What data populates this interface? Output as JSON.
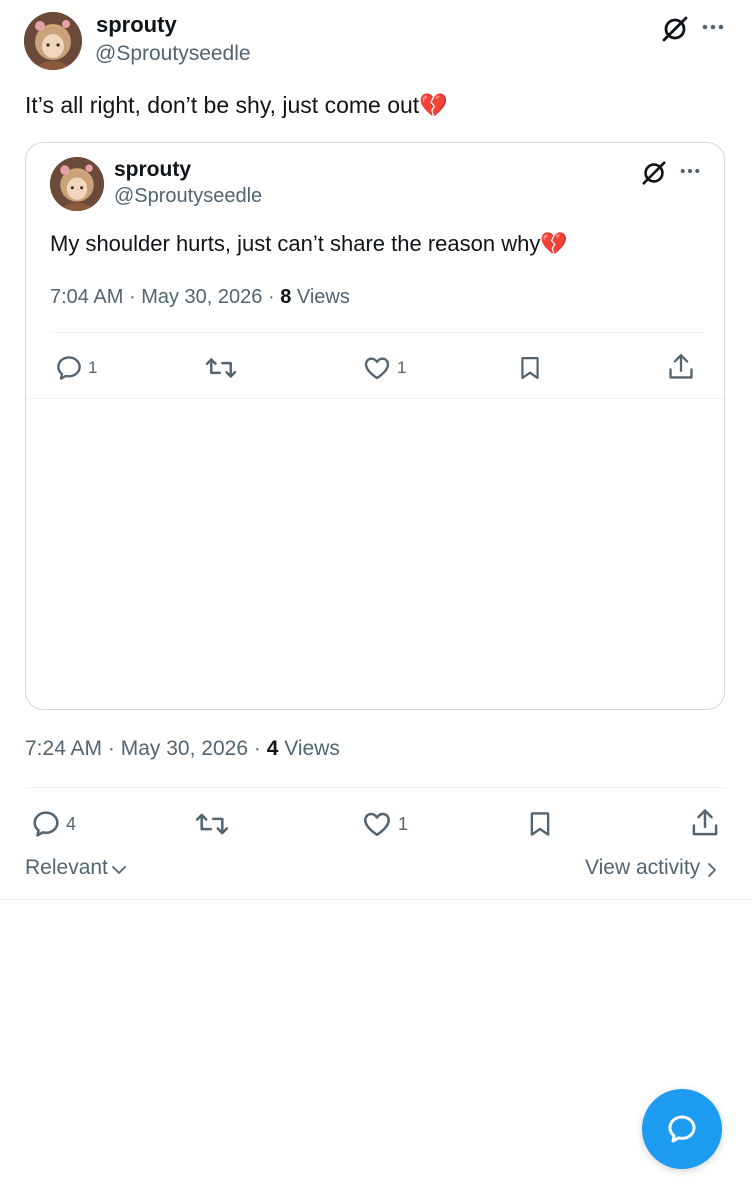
{
  "tweet": {
    "author": {
      "display_name": "sprouty",
      "handle": "@Sproutyseedle"
    },
    "text": "It’s all right, don’t be shy, just come out",
    "emoji": "💔",
    "time": "7:24 AM",
    "date": "May 30, 2026",
    "views_count": "4",
    "views_label": "Views",
    "actions": {
      "replies": "4",
      "reposts": "",
      "likes": "1"
    }
  },
  "quoted_tweet": {
    "author": {
      "display_name": "sprouty",
      "handle": "@Sproutyseedle"
    },
    "text": "My shoulder hurts, just can’t share the reason why",
    "emoji": "💔",
    "time": "7:04 AM",
    "date": "May 30, 2026",
    "views_count": "8",
    "views_label": "Views",
    "actions": {
      "replies": "1",
      "reposts": "",
      "likes": "1"
    }
  },
  "replies_bar": {
    "sort_label": "Relevant",
    "activity_label": "View activity"
  },
  "separator": "·",
  "icons": {
    "grok": "grok-icon",
    "more": "more-icon",
    "reply": "reply-icon",
    "repost": "repost-icon",
    "like": "heart-icon",
    "bookmark": "bookmark-icon",
    "share": "share-icon",
    "compose": "compose-reply-icon"
  },
  "colors": {
    "text_primary": "#0f1419",
    "text_secondary": "#536471",
    "border": "#cfd9de",
    "accent": "#1d9bf0",
    "broken_heart": "#e0245e"
  }
}
